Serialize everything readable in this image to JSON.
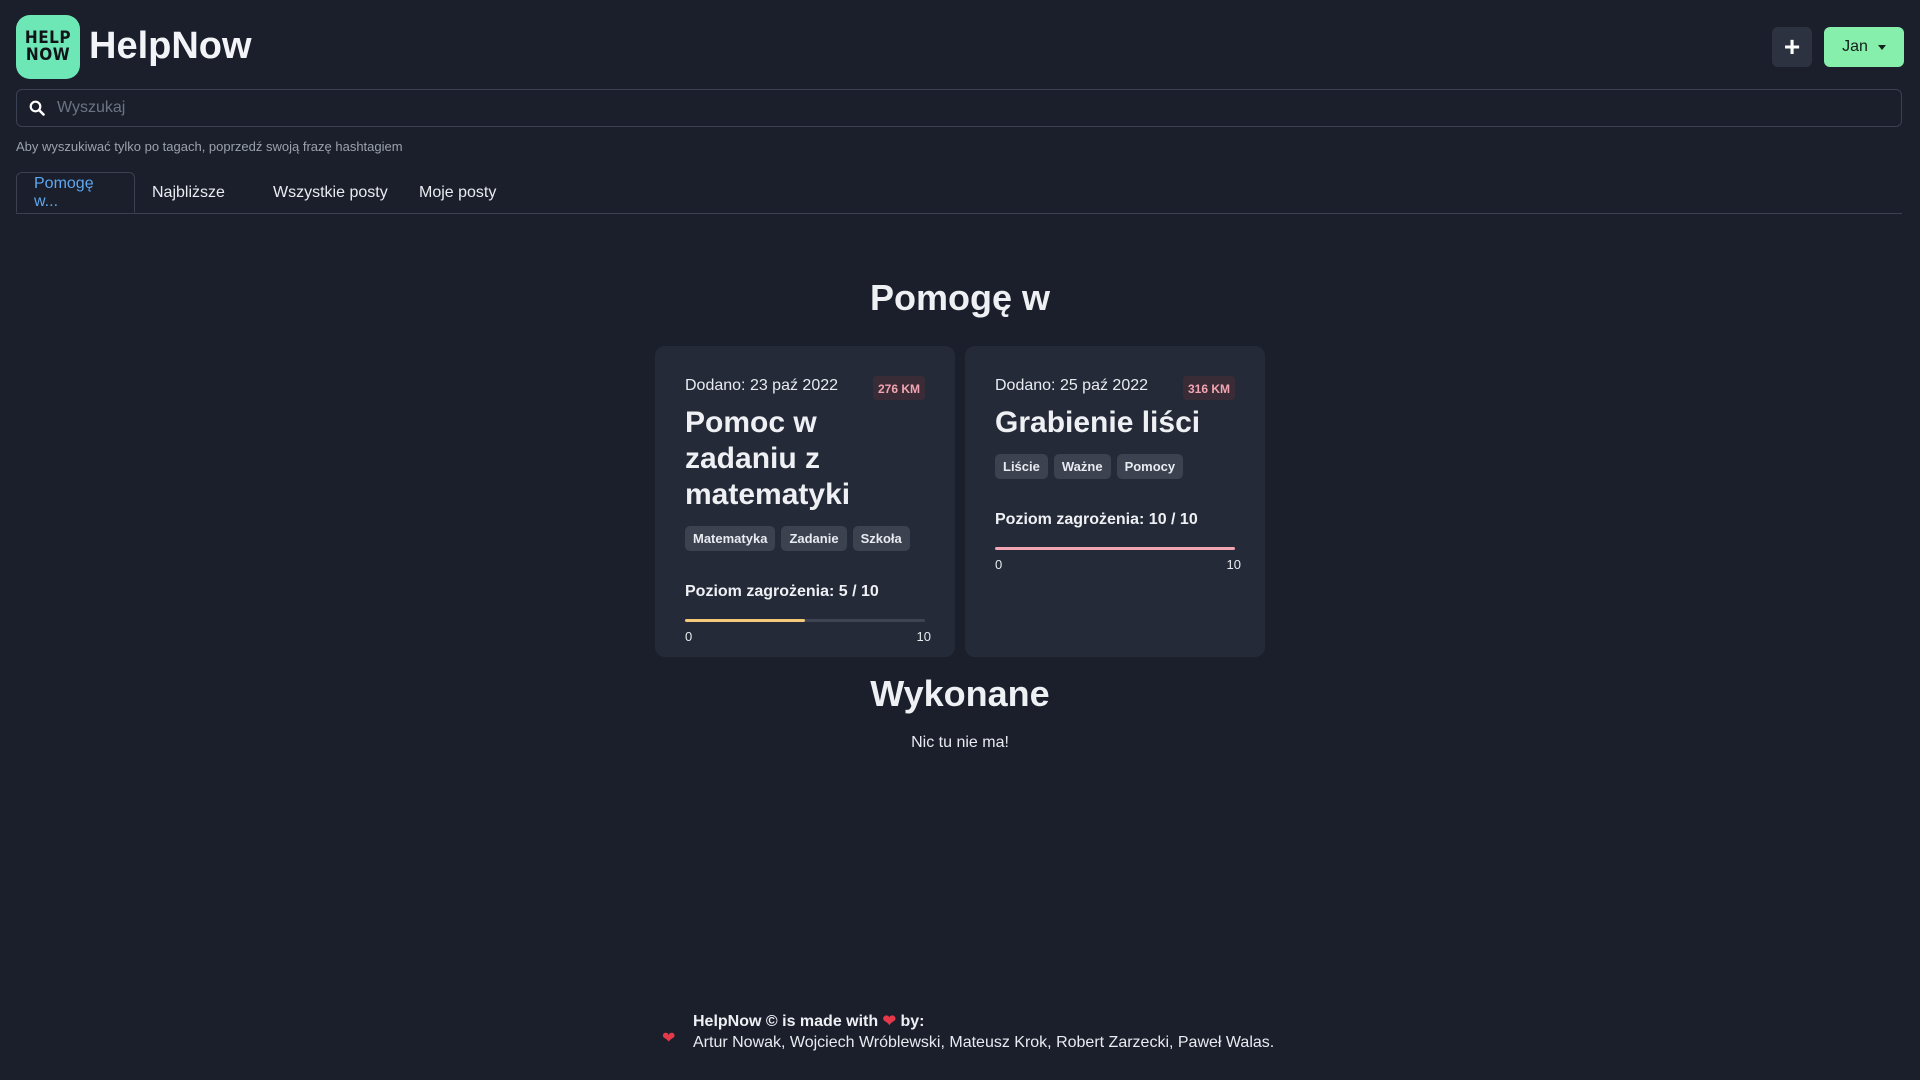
{
  "app": {
    "logo_line1": "HELP",
    "logo_line2": "NOW",
    "title": "HelpNow"
  },
  "header": {
    "plus_label": "+",
    "user_label": "Jan"
  },
  "search": {
    "placeholder": "Wyszukaj",
    "hint": "Aby wyszukiwać tylko po tagach, poprzedź swoją frazę hashtagiem"
  },
  "tabs": [
    {
      "label": "Pomogę w..."
    },
    {
      "label": "Najbliższe"
    },
    {
      "label": "Wszystkie posty"
    },
    {
      "label": "Moje posty"
    }
  ],
  "sections": {
    "help": {
      "title": "Pomogę w"
    },
    "done": {
      "title": "Wykonane",
      "empty": "Nic tu nie ma!"
    }
  },
  "cards": [
    {
      "date": "Dodano: 23 paź 2022",
      "distance": "276 KM",
      "title": "Pomoc w zadaniu z matematyki",
      "tags": [
        "Matematyka",
        "Zadanie",
        "Szkoła"
      ],
      "danger_label": "Poziom zagrożenia: 5 / 10",
      "danger_value": 5,
      "danger_max": 10,
      "range_min": "0",
      "range_max": "10",
      "bar_color": "#f5c87a"
    },
    {
      "date": "Dodano: 25 paź 2022",
      "distance": "316 KM",
      "title": "Grabienie liści",
      "tags": [
        "Liście",
        "Ważne",
        "Pomocy"
      ],
      "danger_label": "Poziom zagrożenia: 10 / 10",
      "danger_value": 10,
      "danger_max": 10,
      "range_min": "0",
      "range_max": "10",
      "bar_color": "#f2a5b2"
    }
  ],
  "footer": {
    "line1_prefix": "HelpNow © is made with",
    "heart": "❤",
    "line1_suffix": "by:",
    "authors": "Artur Nowak, Wojciech Wróblewski, Mateusz Krok, Robert Zarzecki, Paweł Walas."
  },
  "colors": {
    "accent_green": "#86efac",
    "logo_bg": "#6ee7b7",
    "tab_active": "#5ea7f0",
    "background": "#1b1f2b",
    "card_bg": "#252a38"
  }
}
